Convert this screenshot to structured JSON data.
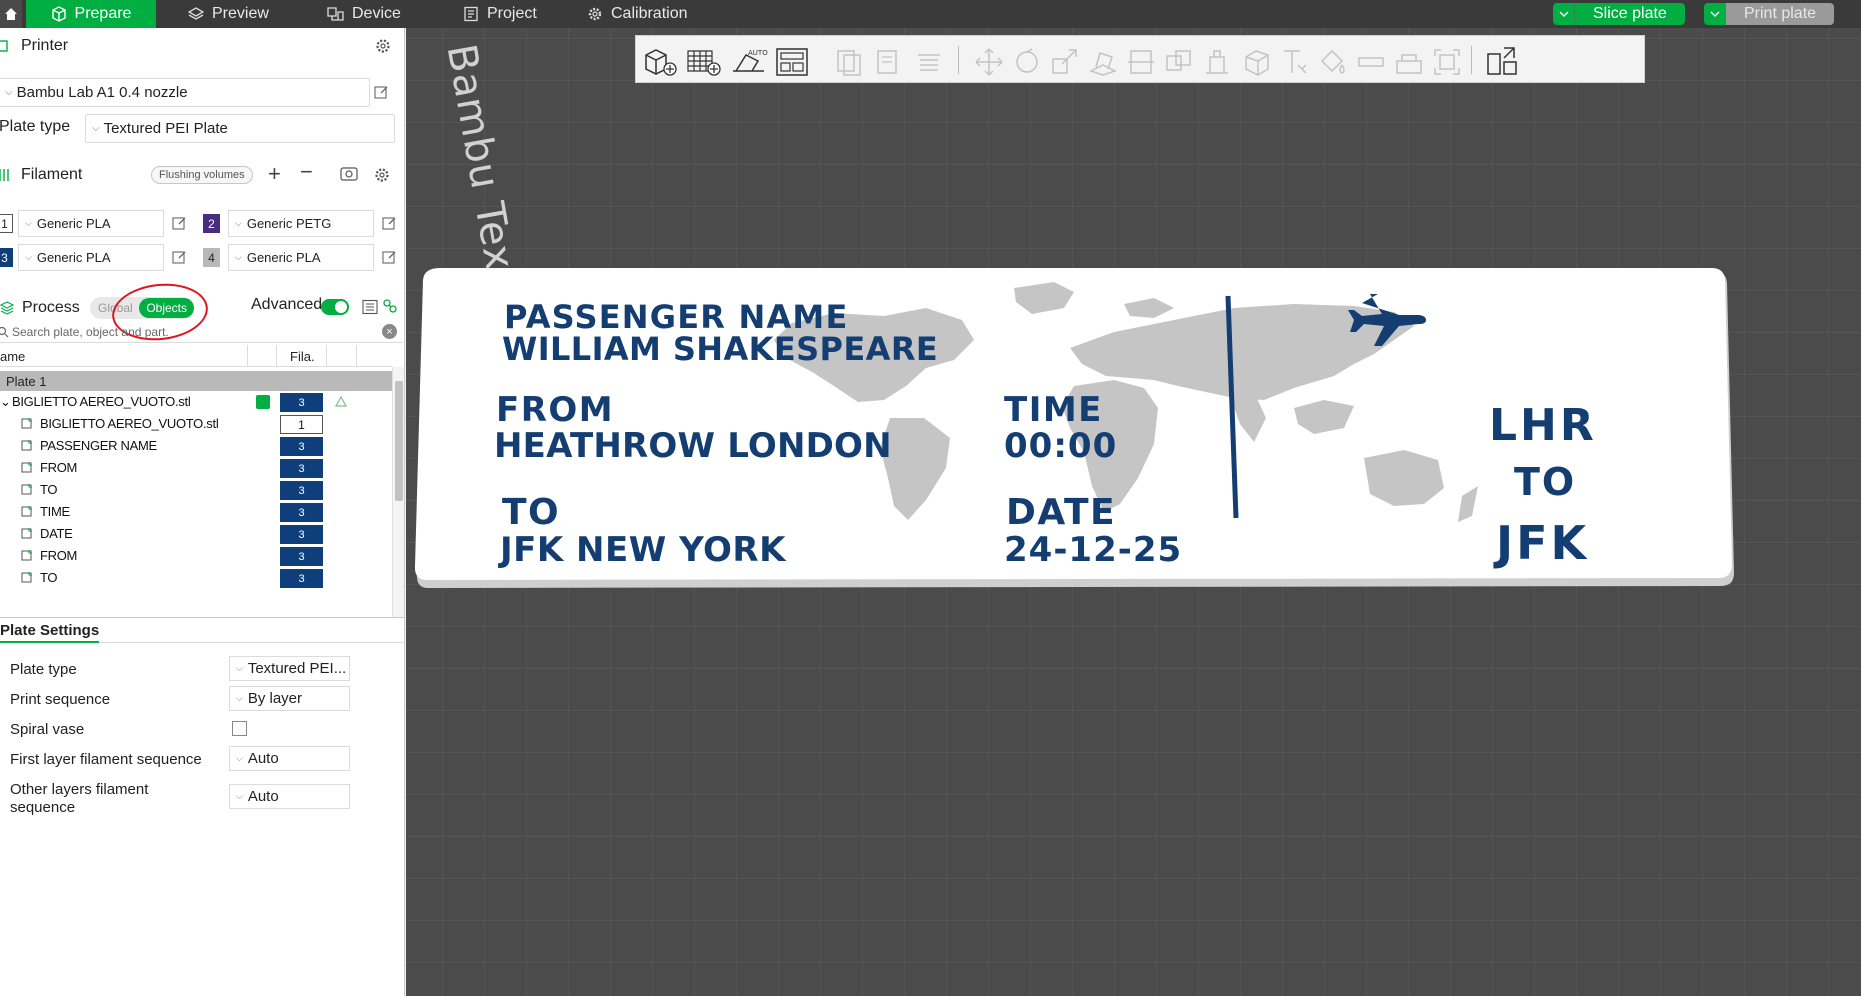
{
  "topbar": {
    "tabs": [
      {
        "label": "Prepare",
        "icon": "cube-icon",
        "active": true
      },
      {
        "label": "Preview",
        "icon": "layers-icon"
      },
      {
        "label": "Device",
        "icon": "device-icon"
      },
      {
        "label": "Project",
        "icon": "document-icon"
      },
      {
        "label": "Calibration",
        "icon": "gear-icon"
      }
    ],
    "slice_label": "Slice plate",
    "print_label": "Print plate",
    "accent": "#00ae42"
  },
  "printer": {
    "title": "Printer",
    "name": "Bambu Lab A1 0.4 nozzle",
    "plate_type_label": "Plate type",
    "plate_type_value": "Textured PEI Plate"
  },
  "filament": {
    "title": "Filament",
    "flushing_label": "Flushing volumes",
    "slots": [
      {
        "num": "1",
        "name": "Generic PLA",
        "color": "#ffffff"
      },
      {
        "num": "2",
        "name": "Generic PETG",
        "color": "#4a2c80"
      },
      {
        "num": "3",
        "name": "Generic PLA",
        "color": "#0f3f7a"
      },
      {
        "num": "4",
        "name": "Generic PLA",
        "color": "#b8b8b8"
      }
    ]
  },
  "process": {
    "title": "Process",
    "global_label": "Global",
    "objects_label": "Objects",
    "advanced_label": "Advanced",
    "search_placeholder": "Search plate, object and part."
  },
  "objects": {
    "col_name": "ame",
    "col_fila": "Fila.",
    "plate": "Plate 1",
    "rows": [
      {
        "name": "BIGLIETTO AEREO_VUOTO.stl",
        "fila": "3",
        "level": 0
      },
      {
        "name": "BIGLIETTO AEREO_VUOTO.stl",
        "fila": "1",
        "level": 1
      },
      {
        "name": "PASSENGER NAME",
        "fila": "3",
        "level": 1
      },
      {
        "name": "FROM",
        "fila": "3",
        "level": 1
      },
      {
        "name": "TO",
        "fila": "3",
        "level": 1
      },
      {
        "name": "TIME",
        "fila": "3",
        "level": 1
      },
      {
        "name": "DATE",
        "fila": "3",
        "level": 1
      },
      {
        "name": "FROM",
        "fila": "3",
        "level": 1
      },
      {
        "name": "TO",
        "fila": "3",
        "level": 1
      }
    ]
  },
  "plate_settings": {
    "title": "Plate Settings",
    "plate_type_label": "Plate type",
    "plate_type_value": "Textured PEI...",
    "print_sequence_label": "Print sequence",
    "print_sequence_value": "By layer",
    "spiral_vase_label": "Spiral vase",
    "first_layer_label": "First layer filament sequence",
    "first_layer_value": "Auto",
    "other_layers_label_1": "Other layers filament",
    "other_layers_label_2": "sequence",
    "other_layers_value": "Auto"
  },
  "viewport": {
    "bed_label": "Bambu Textured PEI Plate",
    "ticket": {
      "passenger_label": "PASSENGER NAME",
      "passenger_value": "WILLIAM SHAKESPEARE",
      "from_label": "FROM",
      "from_value": "HEATHROW LONDON",
      "to_label": "TO",
      "to_value": "JFK NEW YORK",
      "time_label": "TIME",
      "time_value": "00:00",
      "date_label": "DATE",
      "date_value": "24-12-25",
      "origin_code": "LHR",
      "to_word": "TO",
      "dest_code": "JFK"
    }
  }
}
